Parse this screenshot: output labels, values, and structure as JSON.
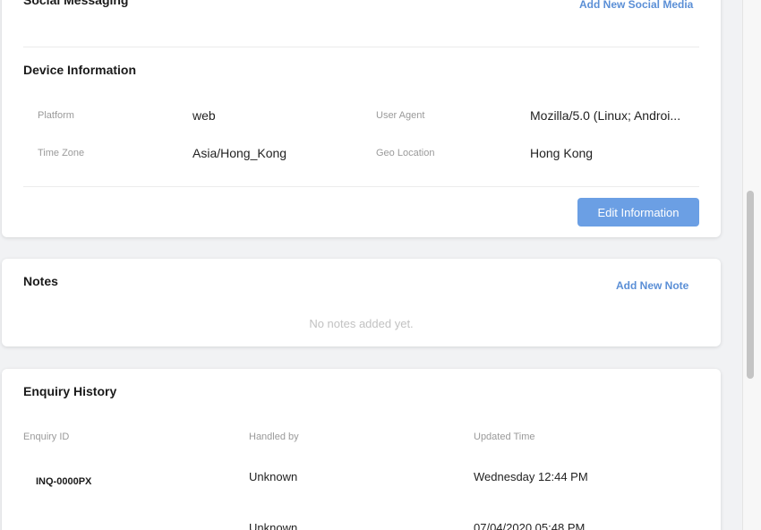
{
  "social_messaging": {
    "title": "Social Messaging",
    "add_link": "Add New Social Media"
  },
  "device_info": {
    "title": "Device Information",
    "fields": [
      {
        "label": "Platform",
        "value": "web"
      },
      {
        "label": "User Agent",
        "value": "Mozilla/5.0 (Linux; Androi..."
      },
      {
        "label": "Time Zone",
        "value": "Asia/Hong_Kong"
      },
      {
        "label": "Geo Location",
        "value": "Hong Kong"
      }
    ],
    "edit_button": "Edit Information"
  },
  "notes": {
    "title": "Notes",
    "add_link": "Add New Note",
    "empty_text": "No notes added yet."
  },
  "enquiry_history": {
    "title": "Enquiry History",
    "columns": [
      "Enquiry ID",
      "Handled by",
      "Updated Time"
    ],
    "rows": [
      {
        "id": "INQ-0000PX",
        "handled_by": "Unknown",
        "updated": "Wednesday 12:44 PM"
      },
      {
        "id": "",
        "handled_by": "Unknown",
        "updated": "07/04/2020 05:48 PM"
      }
    ]
  },
  "colors": {
    "accent": "#6b9fe4",
    "link": "#5b8fd6",
    "background": "#f1f2f4"
  }
}
